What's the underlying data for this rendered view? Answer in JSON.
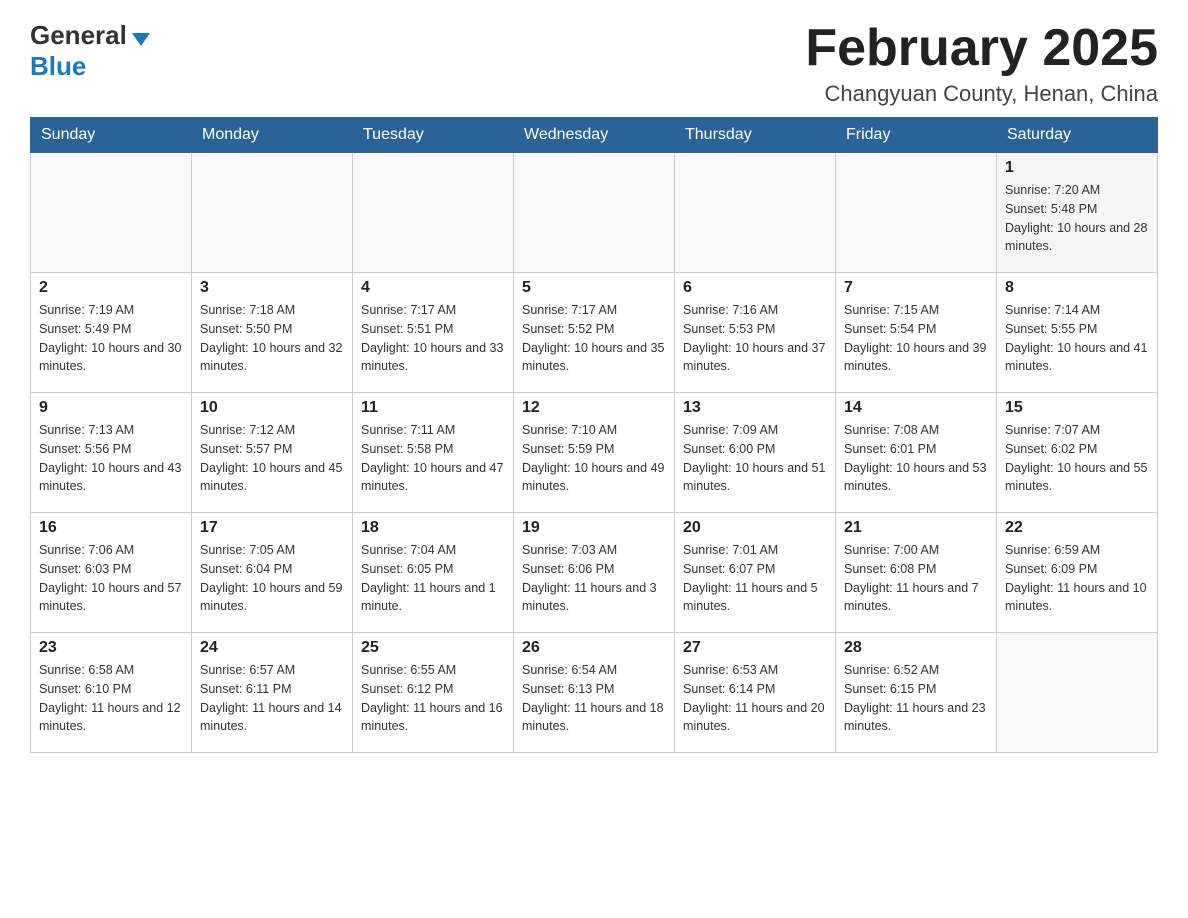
{
  "header": {
    "logo": {
      "general": "General",
      "blue": "Blue",
      "triangle_unicode": "▼"
    },
    "title": "February 2025",
    "location": "Changyuan County, Henan, China"
  },
  "calendar": {
    "days_of_week": [
      "Sunday",
      "Monday",
      "Tuesday",
      "Wednesday",
      "Thursday",
      "Friday",
      "Saturday"
    ],
    "weeks": [
      [
        {
          "day": "",
          "info": ""
        },
        {
          "day": "",
          "info": ""
        },
        {
          "day": "",
          "info": ""
        },
        {
          "day": "",
          "info": ""
        },
        {
          "day": "",
          "info": ""
        },
        {
          "day": "",
          "info": ""
        },
        {
          "day": "1",
          "info": "Sunrise: 7:20 AM\nSunset: 5:48 PM\nDaylight: 10 hours and 28 minutes."
        }
      ],
      [
        {
          "day": "2",
          "info": "Sunrise: 7:19 AM\nSunset: 5:49 PM\nDaylight: 10 hours and 30 minutes."
        },
        {
          "day": "3",
          "info": "Sunrise: 7:18 AM\nSunset: 5:50 PM\nDaylight: 10 hours and 32 minutes."
        },
        {
          "day": "4",
          "info": "Sunrise: 7:17 AM\nSunset: 5:51 PM\nDaylight: 10 hours and 33 minutes."
        },
        {
          "day": "5",
          "info": "Sunrise: 7:17 AM\nSunset: 5:52 PM\nDaylight: 10 hours and 35 minutes."
        },
        {
          "day": "6",
          "info": "Sunrise: 7:16 AM\nSunset: 5:53 PM\nDaylight: 10 hours and 37 minutes."
        },
        {
          "day": "7",
          "info": "Sunrise: 7:15 AM\nSunset: 5:54 PM\nDaylight: 10 hours and 39 minutes."
        },
        {
          "day": "8",
          "info": "Sunrise: 7:14 AM\nSunset: 5:55 PM\nDaylight: 10 hours and 41 minutes."
        }
      ],
      [
        {
          "day": "9",
          "info": "Sunrise: 7:13 AM\nSunset: 5:56 PM\nDaylight: 10 hours and 43 minutes."
        },
        {
          "day": "10",
          "info": "Sunrise: 7:12 AM\nSunset: 5:57 PM\nDaylight: 10 hours and 45 minutes."
        },
        {
          "day": "11",
          "info": "Sunrise: 7:11 AM\nSunset: 5:58 PM\nDaylight: 10 hours and 47 minutes."
        },
        {
          "day": "12",
          "info": "Sunrise: 7:10 AM\nSunset: 5:59 PM\nDaylight: 10 hours and 49 minutes."
        },
        {
          "day": "13",
          "info": "Sunrise: 7:09 AM\nSunset: 6:00 PM\nDaylight: 10 hours and 51 minutes."
        },
        {
          "day": "14",
          "info": "Sunrise: 7:08 AM\nSunset: 6:01 PM\nDaylight: 10 hours and 53 minutes."
        },
        {
          "day": "15",
          "info": "Sunrise: 7:07 AM\nSunset: 6:02 PM\nDaylight: 10 hours and 55 minutes."
        }
      ],
      [
        {
          "day": "16",
          "info": "Sunrise: 7:06 AM\nSunset: 6:03 PM\nDaylight: 10 hours and 57 minutes."
        },
        {
          "day": "17",
          "info": "Sunrise: 7:05 AM\nSunset: 6:04 PM\nDaylight: 10 hours and 59 minutes."
        },
        {
          "day": "18",
          "info": "Sunrise: 7:04 AM\nSunset: 6:05 PM\nDaylight: 11 hours and 1 minute."
        },
        {
          "day": "19",
          "info": "Sunrise: 7:03 AM\nSunset: 6:06 PM\nDaylight: 11 hours and 3 minutes."
        },
        {
          "day": "20",
          "info": "Sunrise: 7:01 AM\nSunset: 6:07 PM\nDaylight: 11 hours and 5 minutes."
        },
        {
          "day": "21",
          "info": "Sunrise: 7:00 AM\nSunset: 6:08 PM\nDaylight: 11 hours and 7 minutes."
        },
        {
          "day": "22",
          "info": "Sunrise: 6:59 AM\nSunset: 6:09 PM\nDaylight: 11 hours and 10 minutes."
        }
      ],
      [
        {
          "day": "23",
          "info": "Sunrise: 6:58 AM\nSunset: 6:10 PM\nDaylight: 11 hours and 12 minutes."
        },
        {
          "day": "24",
          "info": "Sunrise: 6:57 AM\nSunset: 6:11 PM\nDaylight: 11 hours and 14 minutes."
        },
        {
          "day": "25",
          "info": "Sunrise: 6:55 AM\nSunset: 6:12 PM\nDaylight: 11 hours and 16 minutes."
        },
        {
          "day": "26",
          "info": "Sunrise: 6:54 AM\nSunset: 6:13 PM\nDaylight: 11 hours and 18 minutes."
        },
        {
          "day": "27",
          "info": "Sunrise: 6:53 AM\nSunset: 6:14 PM\nDaylight: 11 hours and 20 minutes."
        },
        {
          "day": "28",
          "info": "Sunrise: 6:52 AM\nSunset: 6:15 PM\nDaylight: 11 hours and 23 minutes."
        },
        {
          "day": "",
          "info": ""
        }
      ]
    ]
  }
}
